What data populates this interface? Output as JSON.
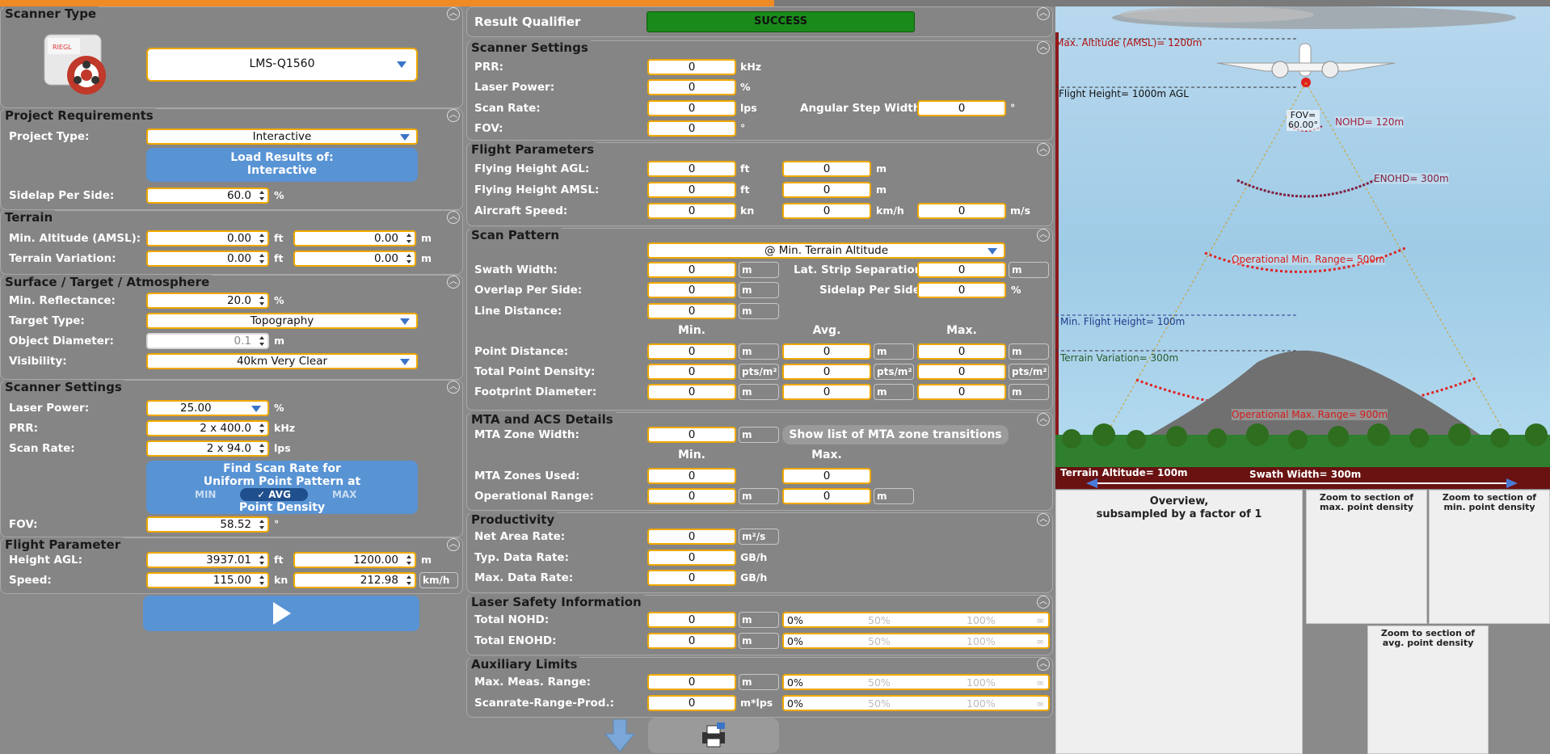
{
  "left": {
    "scanner_type": {
      "title": "Scanner Type",
      "model": "LMS-Q1560"
    },
    "project": {
      "title": "Project Requirements",
      "project_type_label": "Project Type:",
      "project_type": "Interactive",
      "load_btn_line1": "Load Results of:",
      "load_btn_line2": "Interactive",
      "sidelap_label": "Sidelap Per Side:",
      "sidelap": "60.0",
      "sidelap_unit": "%"
    },
    "terrain": {
      "title": "Terrain",
      "min_alt_label": "Min. Altitude (AMSL):",
      "min_alt_ft": "0.00",
      "min_alt_m": "0.00",
      "var_label": "Terrain Variation:",
      "var_ft": "0.00",
      "var_m": "0.00",
      "ft": "ft",
      "m": "m"
    },
    "surface": {
      "title": "Surface / Target / Atmosphere",
      "refl_label": "Min. Reflectance:",
      "refl": "20.0",
      "refl_unit": "%",
      "target_label": "Target Type:",
      "target": "Topography",
      "obj_label": "Object Diameter:",
      "obj": "0.1",
      "obj_unit": "m",
      "vis_label": "Visibility:",
      "vis": "40km Very Clear"
    },
    "scanner": {
      "title": "Scanner Settings",
      "power_label": "Laser Power:",
      "power": "25.00",
      "power_unit": "%",
      "prr_label": "PRR:",
      "prr": "2 x 400.0",
      "prr_unit": "kHz",
      "scan_label": "Scan Rate:",
      "scan": "2 x 94.0",
      "scan_unit": "lps",
      "find_line1": "Find Scan Rate for",
      "find_line2": "Uniform Point Pattern at",
      "opt_min": "MIN",
      "opt_avg": "✓ AVG",
      "opt_max": "MAX",
      "find_line3": "Point Density",
      "fov_label": "FOV:",
      "fov": "58.52",
      "fov_unit": "°"
    },
    "flight": {
      "title": "Flight Parameter",
      "height_label": "Height AGL:",
      "height_ft": "3937.01",
      "height_m": "1200.00",
      "ft": "ft",
      "m": "m",
      "speed_label": "Speed:",
      "speed_kn": "115.00",
      "speed_kmh": "212.98",
      "kn": "kn",
      "kmh": "km/h"
    }
  },
  "mid": {
    "qualifier": {
      "label": "Result Qualifier",
      "value": "SUCCESS"
    },
    "scanner": {
      "title": "Scanner Settings",
      "prr_label": "PRR:",
      "prr": "0",
      "prr_unit": "kHz",
      "power_label": "Laser Power:",
      "power": "0",
      "power_unit": "%",
      "scan_label": "Scan Rate:",
      "scan": "0",
      "scan_unit": "lps",
      "ang_label": "Angular Step Width:",
      "ang": "0",
      "ang_unit": "°",
      "fov_label": "FOV:",
      "fov": "0",
      "fov_unit": "°"
    },
    "flight": {
      "title": "Flight Parameters",
      "agl_label": "Flying Height AGL:",
      "agl_ft": "0",
      "agl_m": "0",
      "amsl_label": "Flying Height AMSL:",
      "amsl_ft": "0",
      "amsl_m": "0",
      "speed_label": "Aircraft Speed:",
      "speed_kn": "0",
      "speed_kmh": "0",
      "speed_ms": "0",
      "ft": "ft",
      "m": "m",
      "kn": "kn",
      "kmh": "km/h",
      "ms": "m/s"
    },
    "pattern": {
      "title": "Scan Pattern",
      "mode": "@ Min. Terrain Altitude",
      "swath_label": "Swath Width:",
      "swath": "0",
      "lat_label": "Lat. Strip Separation:",
      "lat": "0",
      "overlap_label": "Overlap Per Side:",
      "overlap": "0",
      "sidelap_label": "Sidelap Per Side:",
      "sidelap": "0",
      "line_label": "Line Distance:",
      "line": "0",
      "min": "Min.",
      "avg": "Avg.",
      "max": "Max.",
      "pd_label": "Point Distance:",
      "pd_min": "0",
      "pd_avg": "0",
      "pd_max": "0",
      "tpd_label": "Total Point Density:",
      "tpd_min": "0",
      "tpd_avg": "0",
      "tpd_max": "0",
      "fp_label": "Footprint Diameter:",
      "fp_min": "0",
      "fp_avg": "0",
      "fp_max": "0",
      "m": "m",
      "pct": "%",
      "pts": "pts/m²"
    },
    "mta": {
      "title": "MTA and ACS Details",
      "zone_label": "MTA Zone Width:",
      "zone": "0",
      "m": "m",
      "show_btn": "Show list of MTA zone transitions",
      "min": "Min.",
      "max": "Max.",
      "used_label": "MTA Zones Used:",
      "used_min": "0",
      "used_max": "0",
      "op_label": "Operational Range:",
      "op_min": "0",
      "op_max": "0"
    },
    "prod": {
      "title": "Productivity",
      "area_label": "Net Area Rate:",
      "area": "0",
      "area_unit": "m²/s",
      "typ_label": "Typ. Data Rate:",
      "typ": "0",
      "typ_unit": "GB/h",
      "max_label": "Max. Data Rate:",
      "max": "0",
      "max_unit": "GB/h"
    },
    "safety": {
      "title": "Laser Safety Information",
      "nohd_label": "Total NOHD:",
      "nohd": "0",
      "enohd_label": "Total ENOHD:",
      "enohd": "0",
      "m": "m",
      "bar_0": "0%",
      "bar_50": "50%",
      "bar_100": "100%",
      "bar_inf": "∞"
    },
    "aux": {
      "title": "Auxiliary Limits",
      "meas_label": "Max. Meas. Range:",
      "meas": "0",
      "meas_unit": "m",
      "srp_label": "Scanrate-Range-Prod.:",
      "srp": "0",
      "srp_unit": "m*lps",
      "bar_0": "0%",
      "bar_50": "50%",
      "bar_100": "100%",
      "bar_inf": "∞"
    }
  },
  "scene": {
    "max_alt": "Max. Altitude (AMSL)= 1200m",
    "flight_height": "Flight Height= 1000m AGL",
    "fov_line1": "FOV=",
    "fov_line2": "60.00°",
    "nohd": "NOHD= 120m",
    "enohd": "ENOHD= 300m",
    "op_min": "Operational Min. Range= 500m",
    "min_flight": "Min. Flight Height= 100m",
    "terrain_var": "Terrain Variation= 300m",
    "op_max": "Operational Max. Range= 900m",
    "terrain_alt": "Terrain Altitude= 100m",
    "swath": "Swath Width= 300m"
  },
  "preview": {
    "overview_line1": "Overview,",
    "overview_line2": "subsampled by a factor of 1",
    "zmax_line1": "Zoom to section of",
    "zmax_line2": "max. point density",
    "zmin_line1": "Zoom to section of",
    "zmin_line2": "min. point density",
    "zavg_line1": "Zoom to section of",
    "zavg_line2": "avg. point density"
  },
  "colors": {
    "accent": "#f08a24",
    "field_border": "#f0a800",
    "button": "#5893d4",
    "success": "#1a8a1a",
    "warning_text": "#d41b1b"
  }
}
